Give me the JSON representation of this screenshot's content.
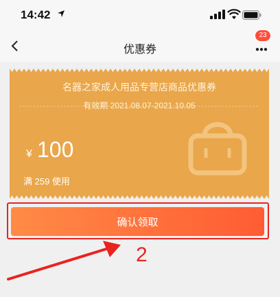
{
  "status_bar": {
    "time": "14:42"
  },
  "nav": {
    "title": "优惠券",
    "badge_count": "23"
  },
  "coupon": {
    "title": "名器之家成人用品专营店商品优惠券",
    "validity": "有效期 2021.08.07-2021.10.05",
    "currency_symbol": "¥",
    "amount": "100",
    "condition": "满 259 使用",
    "color": "#e9a64a"
  },
  "action": {
    "claim_label": "确认领取",
    "accent": "#ff6a3a"
  },
  "annotation": {
    "step_number": "2",
    "color": "#e8241f"
  }
}
